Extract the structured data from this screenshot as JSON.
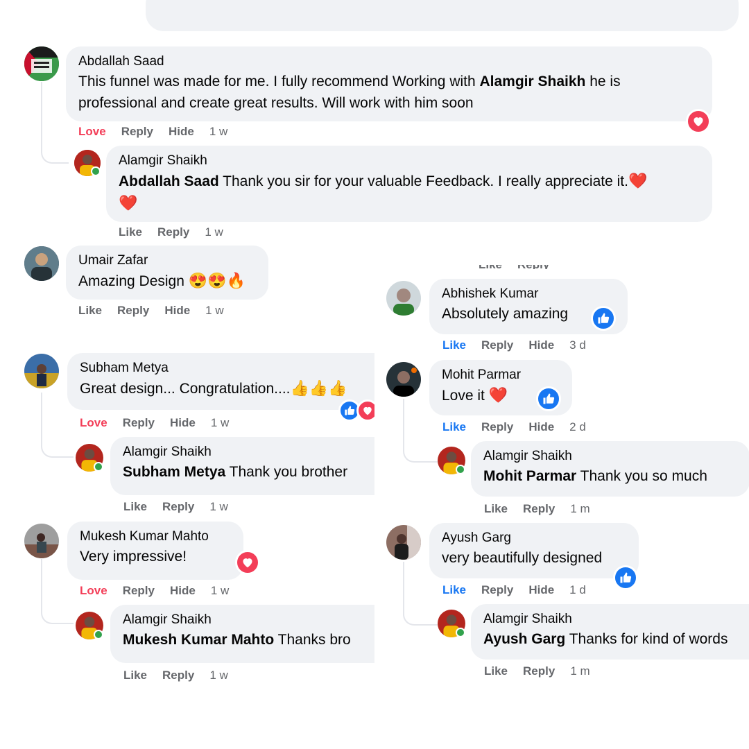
{
  "labels": {
    "love": "Love",
    "like": "Like",
    "reply": "Reply",
    "hide": "Hide"
  },
  "icons": {
    "heart": "heart-icon",
    "like": "thumbs-up-icon"
  },
  "colors": {
    "love": "#f33e58",
    "like": "#1877f2",
    "bubble": "#f0f2f5",
    "meta": "#65676b"
  },
  "left": {
    "c1": {
      "author": "Abdallah Saad",
      "text_pre": "This funnel was made for me. I fully recommend Working with ",
      "mention": "Alamgir Shaikh",
      "text_post": " he is",
      "line2": "professional and create great results. Will work with him soon",
      "time": "1 w"
    },
    "r1": {
      "author": "Alamgir Shaikh",
      "mention": "Abdallah Saad",
      "text": " Thank you sir for your valuable Feedback. I really appreciate it.",
      "emoji": "❤️",
      "emoji2": "❤️",
      "time": "1 w"
    },
    "c2": {
      "author": "Umair Zafar",
      "text": "Amazing Design ",
      "emoji": "😍😍🔥",
      "time": "1 w"
    },
    "c3": {
      "author": "Subham Metya",
      "text": "Great design... Congratulation....",
      "emoji": "👍👍👍",
      "time": "1 w"
    },
    "r3": {
      "author": "Alamgir Shaikh",
      "mention": "Subham Metya",
      "text": " Thank you brother",
      "time": "1 w"
    },
    "c4": {
      "author": "Mukesh Kumar Mahto",
      "text": "Very impressive!",
      "time": "1 w"
    },
    "r4": {
      "author": "Alamgir Shaikh",
      "mention": "Mukesh Kumar Mahto",
      "text": " Thanks bro",
      "time": "1 w"
    }
  },
  "right": {
    "c1": {
      "author": "Abhishek Kumar",
      "text": "Absolutely amazing",
      "time": "3 d"
    },
    "c2": {
      "author": "Mohit Parmar",
      "text": "Love it ",
      "emoji": "❤️",
      "time": "2 d"
    },
    "r2": {
      "author": "Alamgir Shaikh",
      "mention": "Mohit Parmar",
      "text": " Thank you so much",
      "time": "1 m"
    },
    "c3": {
      "author": "Ayush Garg",
      "text": "very beautifully designed",
      "time": "1 d"
    },
    "r3": {
      "author": "Alamgir Shaikh",
      "mention": "Ayush Garg",
      "text": " Thanks for kind of words",
      "time": "1 m"
    }
  }
}
